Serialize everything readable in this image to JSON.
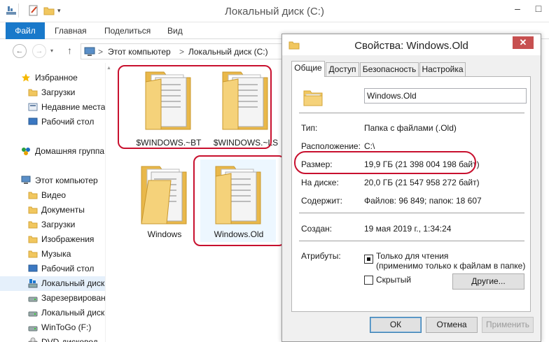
{
  "explorer": {
    "window_title": "Локальный диск (C:)",
    "title_buttons": {
      "minimize": "–",
      "maximize": "□"
    },
    "ribbon_tabs": [
      "Файл",
      "Главная",
      "Поделиться",
      "Вид"
    ],
    "address": {
      "separator": ">",
      "crumbs": [
        "Этот компьютер",
        "Локальный диск (C:)"
      ]
    },
    "nav_items": [
      {
        "label": "Избранное",
        "icon": "star-icon"
      },
      {
        "label": "Загрузки",
        "icon": "downloads-icon"
      },
      {
        "label": "Недавние места",
        "icon": "recent-places-icon"
      },
      {
        "label": "Рабочий стол",
        "icon": "desktop-icon"
      },
      {
        "label": "Домашняя группа",
        "icon": "homegroup-icon"
      },
      {
        "label": "Этот компьютер",
        "icon": "computer-icon"
      },
      {
        "label": "Видео",
        "icon": "videos-icon"
      },
      {
        "label": "Документы",
        "icon": "documents-icon"
      },
      {
        "label": "Загрузки",
        "icon": "downloads-icon"
      },
      {
        "label": "Изображения",
        "icon": "pictures-icon"
      },
      {
        "label": "Музыка",
        "icon": "music-icon"
      },
      {
        "label": "Рабочий стол",
        "icon": "desktop-icon"
      },
      {
        "label": "Локальный диск",
        "icon": "system-drive-icon"
      },
      {
        "label": "Зарезервирован",
        "icon": "drive-icon"
      },
      {
        "label": "Локальный диск",
        "icon": "drive-icon"
      },
      {
        "label": "WinToGo (F:)",
        "icon": "drive-icon"
      },
      {
        "label": "DVD-дисковод",
        "icon": "dvd-drive-icon"
      }
    ],
    "folders": [
      {
        "label": "$WINDOWS.~BT"
      },
      {
        "label": "$WINDOWS.~LS"
      },
      {
        "label": "Windows"
      },
      {
        "label": "Windows.Old"
      }
    ]
  },
  "dialog": {
    "title": "Свойства: Windows.Old",
    "close_glyph": "✕",
    "tabs": [
      "Общие",
      "Доступ",
      "Безопасность",
      "Настройка"
    ],
    "name": "Windows.Old",
    "rows": {
      "type": {
        "label": "Тип:",
        "value": "Папка с файлами (.Old)"
      },
      "location": {
        "label": "Расположение:",
        "value": "C:\\"
      },
      "size": {
        "label": "Размер:",
        "value": "19,9 ГБ (21 398 004 198 байт)"
      },
      "size_on_disk": {
        "label": "На диске:",
        "value": "20,0 ГБ (21 547 958 272 байт)"
      },
      "contains": {
        "label": "Содержит:",
        "value": "Файлов: 96 849; папок: 18 607"
      },
      "created": {
        "label": "Создан:",
        "value": "19 мая 2019 г., 1:34:24"
      }
    },
    "attributes": {
      "label": "Атрибуты:",
      "readonly_label": "Только для чтения",
      "readonly_note": "(применимо только к файлам в папке)",
      "readonly_state": "indeterminate",
      "hidden_label": "Скрытый",
      "hidden_checked": false,
      "other_button": "Другие..."
    },
    "buttons": {
      "ok": "ОК",
      "cancel": "Отмена",
      "apply": "Применить"
    }
  },
  "colors": {
    "accent": "#1979ca",
    "highlight_ring": "#c8102e",
    "folder": "#f1c75f"
  }
}
